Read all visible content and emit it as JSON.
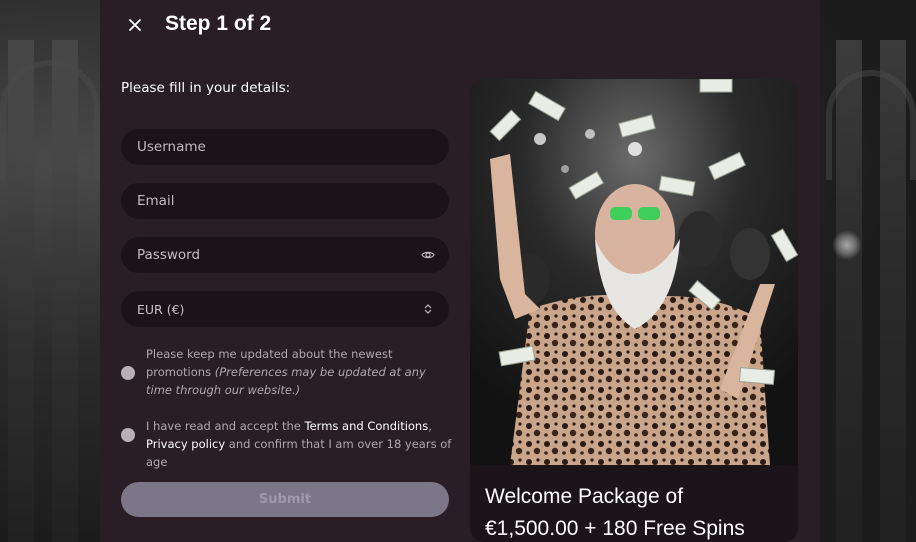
{
  "modal": {
    "close_icon": "close-icon",
    "step_title": "Step 1 of 2",
    "intro": "Please fill in your details:"
  },
  "form": {
    "username_placeholder": "Username",
    "email_placeholder": "Email",
    "password_placeholder": "Password",
    "password_toggle_icon": "eye-icon",
    "currency_value": "EUR (€)",
    "currency_caret_icon": "sort-caret-icon",
    "promotions": {
      "text": "Please keep me updated about the newest promotions",
      "note": "(Preferences may be updated at any time through our website.)"
    },
    "terms": {
      "prefix": "I have read and accept the ",
      "terms_link": "Terms and Conditions",
      "comma": ",",
      "privacy_link": "Privacy policy",
      "suffix": " and confirm that I am over 18 years of age"
    },
    "submit_label": "Submit"
  },
  "promo": {
    "title_line1": "Welcome Package of",
    "title_line2": "€1,500.00 + 180 Free Spins"
  },
  "colors": {
    "modal_bg": "#2a1e26",
    "field_bg": "#1c1318",
    "submit_bg": "#7c7689",
    "radio": "#b7b0b6"
  }
}
